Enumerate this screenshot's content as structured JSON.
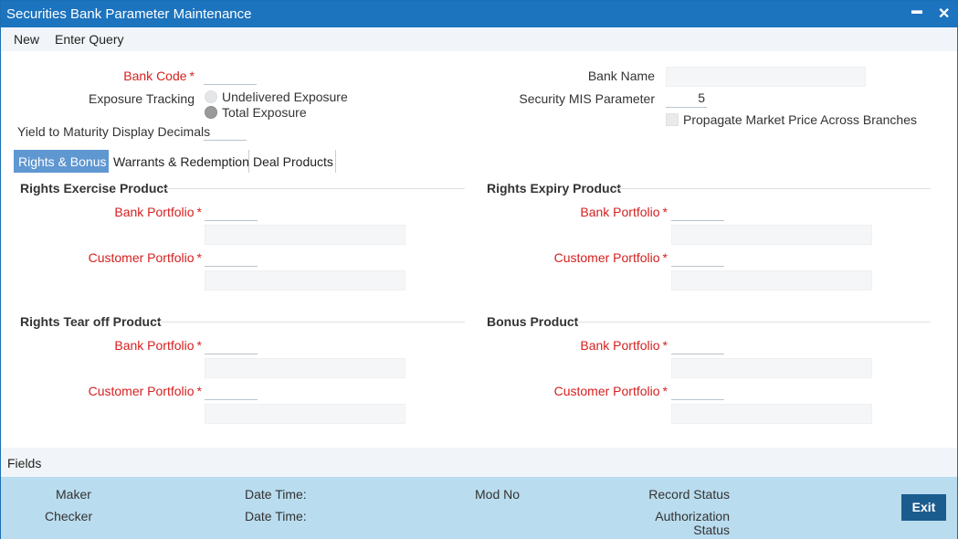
{
  "window": {
    "title": "Securities Bank Parameter Maintenance",
    "minimize": "▬",
    "close": "✕"
  },
  "menu": {
    "new": "New",
    "enter_query": "Enter Query"
  },
  "form": {
    "bank_code": {
      "label": "Bank Code",
      "required": "*",
      "value": ""
    },
    "bank_name": {
      "label": "Bank Name",
      "value": ""
    },
    "exposure_tracking": {
      "label": "Exposure Tracking",
      "options": [
        "Undelivered Exposure",
        "Total Exposure"
      ],
      "selected": "Total Exposure"
    },
    "security_mis_parameter": {
      "label": "Security MIS Parameter",
      "value": "5"
    },
    "propagate": {
      "label": "Propagate Market Price Across Branches",
      "checked": false
    },
    "ytm_decimals": {
      "label": "Yield to Maturity Display Decimals",
      "value": ""
    }
  },
  "tabs": [
    "Rights & Bonus",
    "Warrants & Redemption",
    "Deal Products"
  ],
  "active_tab": "Rights & Bonus",
  "sections": {
    "rights_exercise": {
      "title": "Rights Exercise Product",
      "bank_portfolio": "Bank Portfolio",
      "customer_portfolio": "Customer Portfolio",
      "required": "*"
    },
    "rights_expiry": {
      "title": "Rights Expiry Product",
      "bank_portfolio": "Bank Portfolio",
      "customer_portfolio": "Customer Portfolio",
      "required": "*"
    },
    "rights_tear_off": {
      "title": "Rights Tear off Product",
      "bank_portfolio": "Bank Portfolio",
      "customer_portfolio": "Customer Portfolio",
      "required": "*"
    },
    "bonus": {
      "title": "Bonus Product",
      "bank_portfolio": "Bank Portfolio",
      "customer_portfolio": "Customer Portfolio",
      "required": "*"
    }
  },
  "fields_bar": {
    "label": "Fields"
  },
  "footer": {
    "maker": "Maker",
    "checker": "Checker",
    "date_time_1": "Date Time:",
    "date_time_2": "Date Time:",
    "mod_no": "Mod No",
    "record_status": "Record Status",
    "authorization_status_1": "Authorization",
    "authorization_status_2": "Status",
    "exit": "Exit"
  },
  "colors": {
    "title_bar": "#1c73be",
    "active_tab": "#5f97d1",
    "required": "#d62020",
    "footer": "#b9dcee",
    "exit_button": "#1b5c8f"
  }
}
